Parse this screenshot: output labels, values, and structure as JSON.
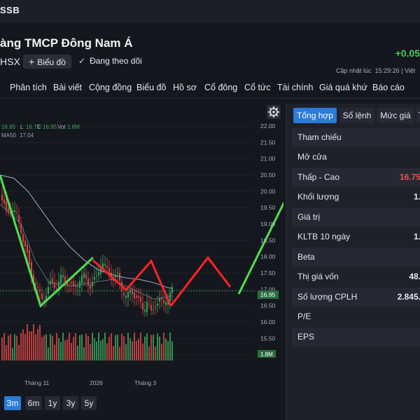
{
  "header": {
    "ticker_fragment": "SSB",
    "company_fragment": "àng TMCP Đông Nam Á",
    "exchange_fragment": "HSX",
    "chart_button_label": "Biểu đồ",
    "follow_label": "Đang theo dõi",
    "change_fragment": "+0.05",
    "updated_label": "Cập nhật lúc",
    "updated_time": "15:29:26",
    "updated_tail": "| Việt"
  },
  "nav": [
    "Phân tích",
    "Bài viết",
    "Cộng đồng",
    "Biểu đồ",
    "Hồ sơ",
    "Cổ đông",
    "Cổ tức",
    "Tài chính",
    "Giá quá khứ",
    "Báo cáo"
  ],
  "chart": {
    "ohlc_line": {
      "h_fragment": "16.95",
      "l_label": "L",
      "l_value": "16.75",
      "c_label": "C",
      "c_value": "16.95",
      "vol_label": "Vol",
      "vol_value": "1.8M"
    },
    "ma_label": "MA50",
    "ma_value": "17.04",
    "price_ticks": [
      "22.00",
      "21.50",
      "21.00",
      "20.50",
      "20.00",
      "19.50",
      "19.00",
      "18.50",
      "18.00",
      "17.50",
      "17.00",
      "16.50",
      "16.00",
      "15.50",
      "15.00"
    ],
    "last_price_tag": "16.95",
    "volume_tag": "1.8M",
    "x_labels": [
      "Tháng 11",
      "2026",
      "Tháng 3"
    ],
    "colors": {
      "up": "#3aa35a",
      "down": "#d64545",
      "ma": "#8ea7bf",
      "green_overlay": "#4ee04e",
      "red_overlay": "#ff2323"
    }
  },
  "panel": {
    "tabs": [
      "Tổng hợp",
      "Sổ lệnh",
      "Mức giá",
      "T"
    ],
    "rows": [
      {
        "label": "Tham chiếu",
        "value": ""
      },
      {
        "label": "Mở cửa",
        "value": ""
      },
      {
        "label": "Thấp - Cao",
        "value": "16.75"
      },
      {
        "label": "Khối lượng",
        "value": "1."
      },
      {
        "label": "Giá trị",
        "value": ""
      },
      {
        "label": "KLTB 10 ngày",
        "value": "1."
      },
      {
        "label": "Beta",
        "value": ""
      },
      {
        "label": "Thị giá vốn",
        "value": "48."
      },
      {
        "label": "Số lượng CPLH",
        "value": "2.845."
      },
      {
        "label": "P/E",
        "value": ""
      },
      {
        "label": "EPS",
        "value": ""
      }
    ]
  },
  "ranges": [
    "3m",
    "6m",
    "1y",
    "3y",
    "5y"
  ]
}
